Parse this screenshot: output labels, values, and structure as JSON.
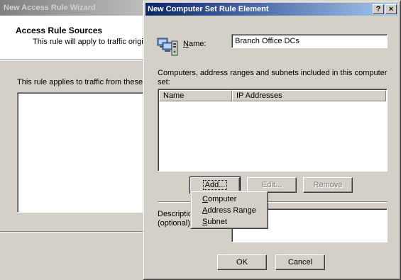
{
  "background_wizard": {
    "title": "New Access Rule Wizard",
    "header_title": "Access Rule Sources",
    "header_subtitle": "This rule will apply to traffic originati",
    "description": "This rule applies to traffic from these sou"
  },
  "dialog": {
    "title": "New Computer Set Rule Element",
    "help_glyph": "?",
    "close_glyph": "×",
    "name_label_mnemonic": "N",
    "name_label_rest": "ame:",
    "name_value": "Branch Office DCs",
    "included_label": "Computers, address ranges and subnets included in this computer set:",
    "columns": [
      "Name",
      "IP Addresses"
    ],
    "add_label": "Add...",
    "edit_label": "Edit...",
    "remove_label": "Remove",
    "description_label_line1": "Descriptio",
    "description_label_line2": "(optional):",
    "ok_label": "OK",
    "cancel_label": "Cancel"
  },
  "menu": {
    "items": [
      {
        "mnemonic": "C",
        "rest": "omputer"
      },
      {
        "mnemonic": "A",
        "rest": "ddress Range"
      },
      {
        "mnemonic": "S",
        "rest": "ubnet"
      }
    ]
  }
}
